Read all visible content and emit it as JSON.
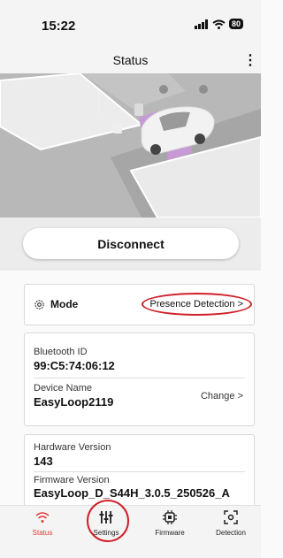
{
  "status_bar": {
    "time": "15:22",
    "battery": "80"
  },
  "header": {
    "title": "Status",
    "menu_icon": "more-vertical-icon"
  },
  "hero": {
    "image": "parking-scene-illustration"
  },
  "disconnect_button": {
    "label": "Disconnect"
  },
  "mode": {
    "label": "Mode",
    "value": "Presence Detection >"
  },
  "bluetooth": {
    "label": "Bluetooth ID",
    "value": "99:C5:74:06:12"
  },
  "device_name": {
    "label": "Device Name",
    "value": "EasyLoop2119",
    "change_label": "Change >"
  },
  "hardware": {
    "label": "Hardware Version",
    "value": "143"
  },
  "firmware": {
    "label": "Firmware Version",
    "value": "EasyLoop_D_S44H_3.0.5_250526_A"
  },
  "tabs": [
    {
      "label": "Status",
      "icon": "wifi-icon",
      "active": true
    },
    {
      "label": "Settings",
      "icon": "sliders-icon",
      "active": false
    },
    {
      "label": "Firmware",
      "icon": "chip-icon",
      "active": false
    },
    {
      "label": "Detection",
      "icon": "detection-icon",
      "active": false
    }
  ],
  "colors": {
    "accent": "#e03a3a",
    "annotation": "#d0202a"
  }
}
